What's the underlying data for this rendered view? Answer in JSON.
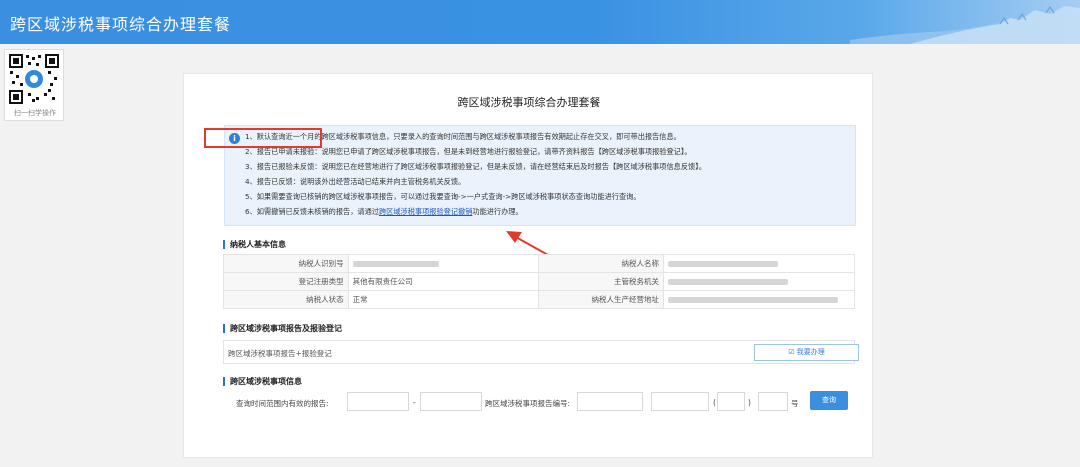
{
  "header": {
    "title": "跨区域涉税事项综合办理套餐"
  },
  "qr": {
    "caption": "扫一扫学操作"
  },
  "main": {
    "title": "跨区域涉税事项综合办理套餐",
    "notice": [
      "1、默认查询近一个月的跨区域涉税事项信息，只要录入的查询时间范围与跨区域涉税事项报告有效期起止存在交叉，即可带出报告信息。",
      "2、报告已申请未报验：说明您已申请了跨区域涉税事项报告，但是未到经营地进行报验登记，请带齐资料报告【跨区域涉税事项报验登记】。",
      "3、报告已报验未反馈：说明您已在经营地进行了跨区域涉税事项报验登记，但是未反馈，请在经营结束后及时报告【跨区域涉税事项信息反馈】。",
      "4、报告已反馈：说明该外出经营活动已结束并向主管税务机关反馈。",
      "5、如果需要查询已核销的跨区域涉税事项报告，可以通过我要查询->一户式查询->跨区域涉税事项状态查询功能进行查询。"
    ],
    "notice_last": {
      "prefix": "6、如需撤销已反馈未核销的报告，请通过",
      "link": "跨区域涉税事项报验登记撤销",
      "suffix": "功能进行办理。"
    }
  },
  "taxpayer": {
    "section_title": "纳税人基本信息",
    "rows": [
      {
        "l1": "纳税人识别号",
        "v1": "",
        "l2": "纳税人名称",
        "v2": ""
      },
      {
        "l1": "登记注册类型",
        "v1": "其他有限责任公司",
        "l2": "主管税务机关",
        "v2": ""
      },
      {
        "l1": "纳税人状态",
        "v1": "正常",
        "l2": "纳税人生产经营地址",
        "v2": ""
      }
    ]
  },
  "report": {
    "section_title": "跨区域涉税事项报告及报验登记",
    "item": "跨区域涉税事项报告+报验登记",
    "button": "☑ 我要办理"
  },
  "query": {
    "section_title": "跨区域涉税事项信息",
    "range_label": "查询时间范围内有效的报告:",
    "dash": "-",
    "number_label": "跨区域涉税事项报告编号:",
    "paren_open": "(",
    "paren_close": ")",
    "hao": "号",
    "button": "查询"
  },
  "colors": {
    "header": "#3a8fe0",
    "accent": "#2f6fd0",
    "highlight": "#e23b2e"
  }
}
